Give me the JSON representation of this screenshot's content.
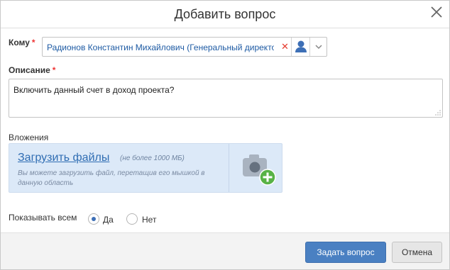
{
  "dialog": {
    "title": "Добавить вопрос",
    "close_icon": "close-icon"
  },
  "to": {
    "label": "Кому",
    "required_mark": "*",
    "value": "Радионов Константин Михайлович (Генеральный директор)",
    "remove_icon": "remove-x-icon",
    "user_icon": "user-icon",
    "dropdown_icon": "chevron-down-icon"
  },
  "description": {
    "label": "Описание",
    "required_mark": "*",
    "value": "Включить данный счет в доход проекта?"
  },
  "attachments": {
    "label": "Вложения",
    "upload_link": "Загрузить файлы",
    "limit": "(не более 1000 МБ)",
    "hint": "Вы можете загрузить файл, перетащив его мышкой в данную область",
    "camera_icon": "camera-add-icon"
  },
  "visibility": {
    "label": "Показывать всем",
    "options": [
      {
        "label": "Да",
        "checked": true
      },
      {
        "label": "Нет",
        "checked": false
      }
    ]
  },
  "footer": {
    "submit_label": "Задать вопрос",
    "cancel_label": "Отмена"
  },
  "colors": {
    "primary": "#4a80c2",
    "link": "#2f6db3",
    "required": "#e33333",
    "dropzone_bg": "#dce9f8",
    "plus_badge": "#58b246"
  }
}
